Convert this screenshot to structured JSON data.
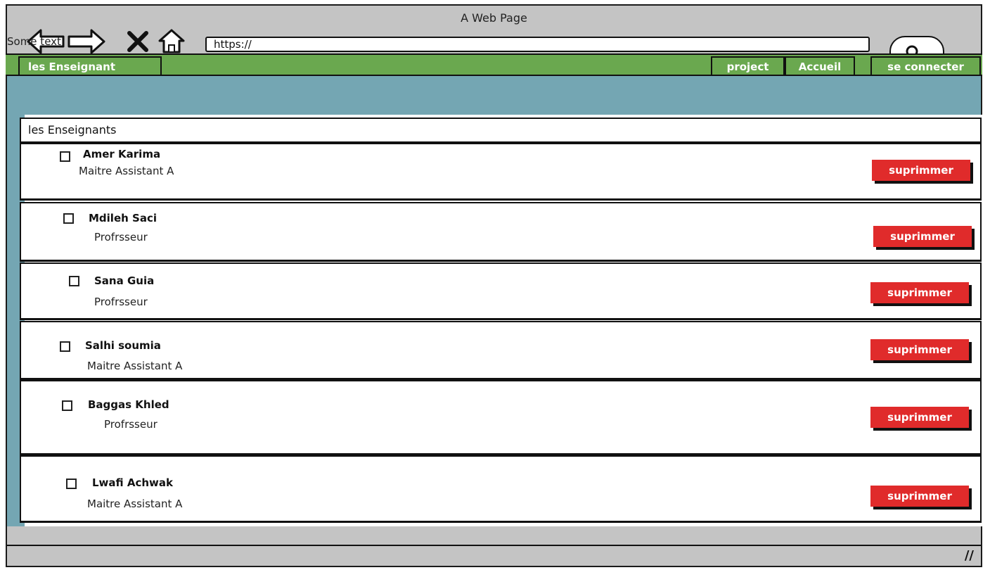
{
  "window": {
    "title": "A Web Page",
    "overlay_text": "Some text"
  },
  "browser": {
    "url": "https://",
    "icons": [
      "back-arrow-icon",
      "forward-arrow-icon",
      "close-icon",
      "home-icon",
      "search-icon"
    ]
  },
  "menu": {
    "left_item": "les Enseignant",
    "right_items": [
      "project",
      "Accueil",
      "se connecter"
    ]
  },
  "list": {
    "heading": "les Enseignants",
    "delete_label": "suprimmer",
    "teachers": [
      {
        "name": "Amer Karima",
        "rank": "Maitre Assistant A"
      },
      {
        "name": "Mdileh Saci",
        "rank": "Profrsseur"
      },
      {
        "name": "Sana Guia",
        "rank": "Profrsseur"
      },
      {
        "name": "Salhi soumia",
        "rank": "Maitre Assistant A"
      },
      {
        "name": "Baggas Khled",
        "rank": "Profrsseur"
      },
      {
        "name": "Lwafi Achwak",
        "rank": "Maitre Assistant A"
      }
    ]
  },
  "colors": {
    "menubar": "#6aa84f",
    "content_bg": "#74a6b3",
    "delete_button": "#e02b2b",
    "chrome": "#c4c4c4"
  }
}
